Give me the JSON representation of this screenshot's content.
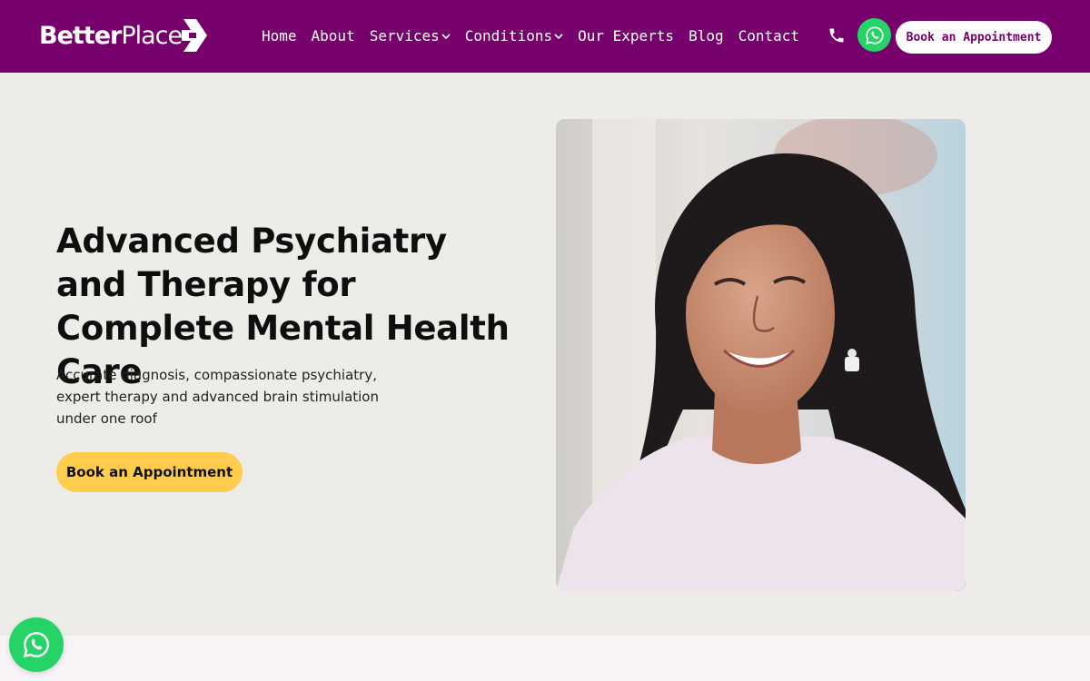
{
  "brand": {
    "name_bold": "Better",
    "name_light": "Place",
    "color": "#76006c"
  },
  "nav": {
    "items": [
      {
        "label": "Home",
        "dropdown": false
      },
      {
        "label": "About",
        "dropdown": false
      },
      {
        "label": "Services",
        "dropdown": true
      },
      {
        "label": "Conditions",
        "dropdown": true
      },
      {
        "label": "Our Experts",
        "dropdown": false
      },
      {
        "label": "Blog",
        "dropdown": false
      },
      {
        "label": "Contact",
        "dropdown": false
      }
    ],
    "phone_icon": "phone-icon",
    "whatsapp_icon": "whatsapp-icon",
    "cta_label": "Book an Appointment"
  },
  "hero": {
    "title": "Advanced Psychiatry and Therapy for Complete Mental Health Care",
    "subtitle": "Accurate diagnosis, compassionate psychiatry, expert therapy and advanced brain stimulation under one roof",
    "cta_label": "Book an Appointment",
    "cta_color": "#ffcc4d"
  },
  "floating": {
    "whatsapp_icon": "whatsapp-icon",
    "color": "#25d366"
  }
}
